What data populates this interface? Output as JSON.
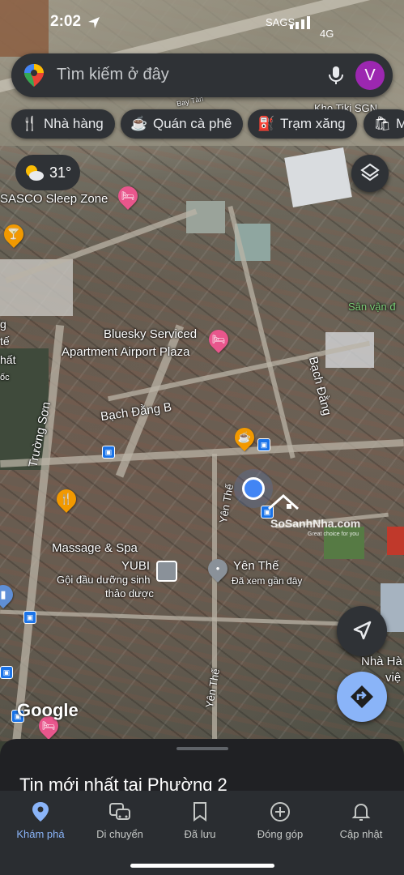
{
  "status_bar": {
    "time": "2:02",
    "carrier": "SAGS",
    "network": "4G"
  },
  "search": {
    "placeholder": "Tìm kiếm ở đây",
    "avatar_letter": "V",
    "avatar_color": "#9c27b0"
  },
  "chips": [
    {
      "label": "Nhà hàng",
      "icon": "restaurant-icon"
    },
    {
      "label": "Quán cà phê",
      "icon": "coffee-icon"
    },
    {
      "label": "Trạm xăng",
      "icon": "gas-station-icon"
    },
    {
      "label": "M",
      "icon": "shopping-bag-icon"
    }
  ],
  "weather": {
    "temperature": "31°",
    "icon": "partly-sunny-icon"
  },
  "map": {
    "labels": {
      "sasco": "SASCO Sleep Zone",
      "kho_tiki": "Kho Tiki SGN",
      "bay_tan": "Bay Tân",
      "bluesky_line1": "Bluesky Serviced",
      "bluesky_line2": "Apartment Airport Plaza",
      "bach_dang_b": "Bạch Đằng B",
      "bach_dang": "Bạch Đằng",
      "truong_son": "Trường Sơn",
      "san_van_do": "Sân vận đ",
      "massage_line1": "Massage & Spa",
      "massage_line2": "YUBI",
      "goi_dau_line1": "Gội đầu dưỡng sinh",
      "goi_dau_line2": "thảo dược",
      "yen_the_road": "Yên Thế",
      "yen_the_road_2": "Yên Thế",
      "yen_the_place": "Yên Thế",
      "yen_the_seen": "Đã xem gần đây",
      "nha_ha": "Nhà Hà",
      "nha_ha_2": "việ",
      "left_te": "tế",
      "left_nhat": "hất",
      "left_oc": "ốc",
      "left_g": "g",
      "logo": "Google"
    },
    "watermark": {
      "name": "SoSanhNha.com",
      "tagline": "Great choice for you"
    }
  },
  "bottom_sheet": {
    "title": "Tin mới nhất tại Phường 2"
  },
  "nav": [
    {
      "label": "Khám phá",
      "icon": "explore-pin-icon",
      "active": true
    },
    {
      "label": "Di chuyển",
      "icon": "commute-icon",
      "active": false
    },
    {
      "label": "Đã lưu",
      "icon": "bookmark-icon",
      "active": false
    },
    {
      "label": "Đóng góp",
      "icon": "add-circle-icon",
      "active": false
    },
    {
      "label": "Cập nhật",
      "icon": "bell-icon",
      "active": false
    }
  ],
  "colors": {
    "accent": "#8ab4f8",
    "surface": "#2f3236",
    "location_dot": "#4285f4"
  }
}
